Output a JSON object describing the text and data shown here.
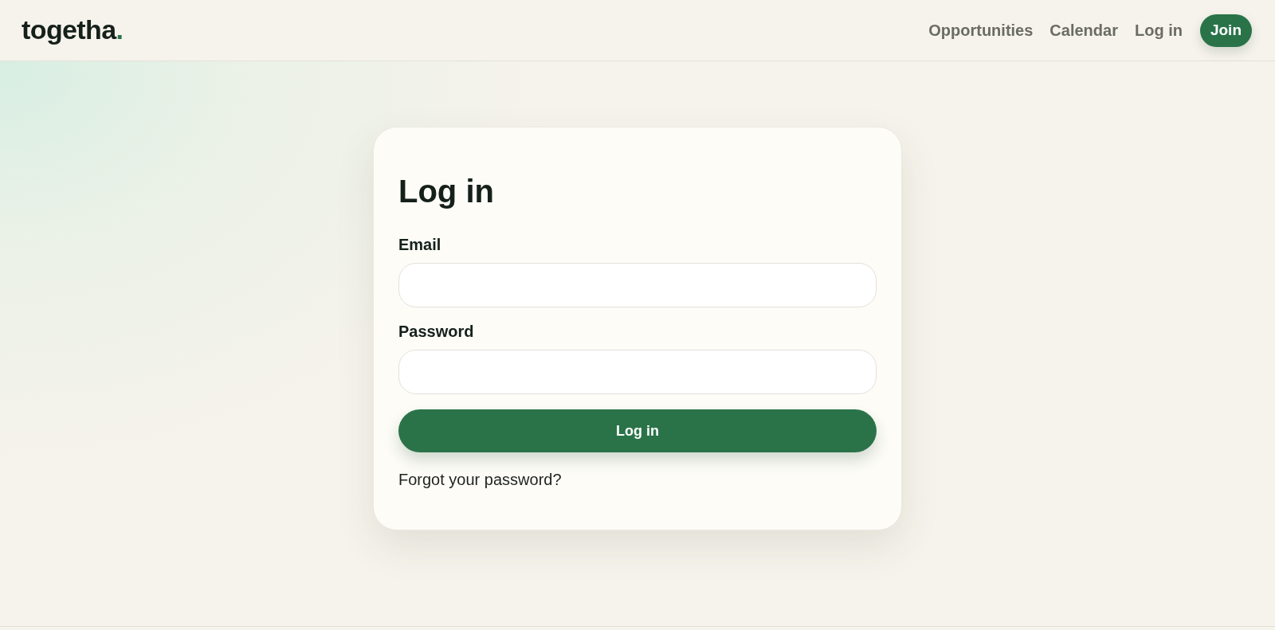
{
  "header": {
    "logo": {
      "text": "togetha",
      "dot": "."
    },
    "nav": [
      {
        "label": "Opportunities"
      },
      {
        "label": "Calendar"
      },
      {
        "label": "Log in"
      }
    ],
    "join_button": "Join"
  },
  "login_card": {
    "title": "Log in",
    "fields": [
      {
        "label": "Email"
      },
      {
        "label": "Password"
      }
    ],
    "submit_button": "Log in",
    "forgot_link": "Forgot your password?"
  }
}
